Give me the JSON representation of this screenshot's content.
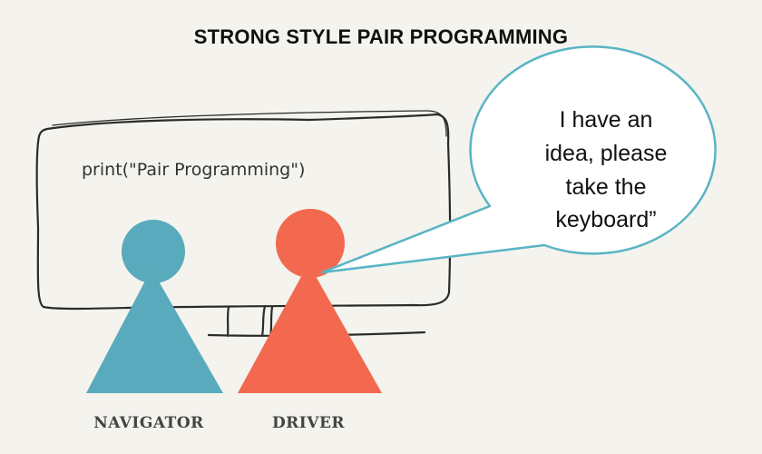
{
  "title": "STRONG STYLE PAIR PROGRAMMING",
  "screen": {
    "code": "print(\"Pair Programming\")"
  },
  "bubble": {
    "lines": [
      "I have an",
      "idea, please",
      "take the",
      "keyboard”"
    ]
  },
  "navigator": {
    "label": "NAVIGATOR",
    "color": "#5aaabd"
  },
  "driver": {
    "label": "DRIVER",
    "color": "#f2694f"
  },
  "colors": {
    "background": "#f4f3ee",
    "bubble_stroke": "#5ab4c4",
    "sketch_line": "#2b2b2b"
  }
}
